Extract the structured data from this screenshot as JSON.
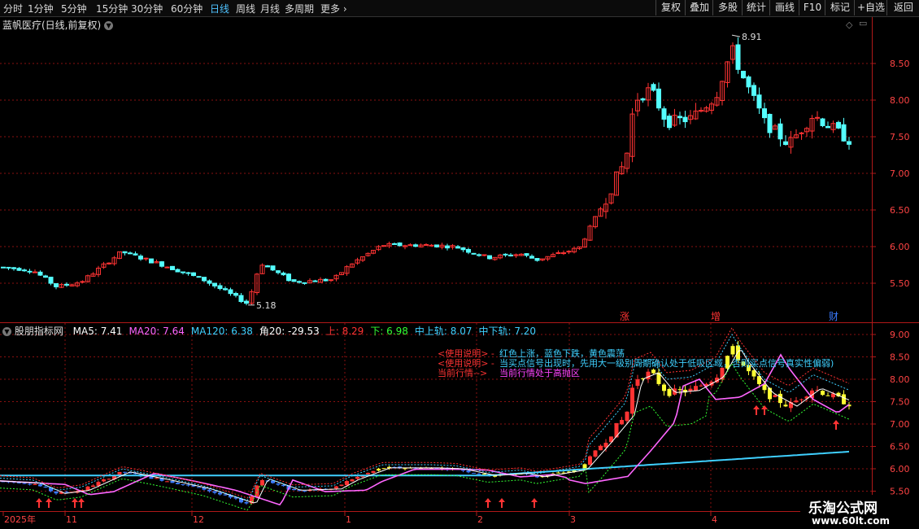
{
  "toolbar": {
    "periods": [
      "分时",
      "1分钟",
      "5分钟",
      "15分钟",
      "30分钟",
      "60分钟",
      "日线",
      "周线",
      "月线",
      "多周期",
      "更多"
    ],
    "active_period": "日线",
    "buttons": [
      "复权",
      "叠加",
      "多股",
      "统计",
      "画线",
      "F10",
      "标记",
      "+自选",
      "返回"
    ]
  },
  "main_chart": {
    "title": "蓝帆医疗(日线,前复权)",
    "y_ticks": [
      "8.50",
      "8.00",
      "7.50",
      "7.00",
      "6.50",
      "6.00",
      "5.50"
    ],
    "high_label": "8.91",
    "low_label": "5.18",
    "event_markers": [
      "涨",
      "增",
      "财"
    ]
  },
  "indicator": {
    "name": "股朋指标网",
    "items": [
      {
        "label": "MA5: 7.41",
        "color": "#ffffff"
      },
      {
        "label": "MA20: 7.64",
        "color": "#ff66ff"
      },
      {
        "label": "MA120: 6.38",
        "color": "#3fd0ff"
      },
      {
        "label": "角20: -29.53",
        "color": "#ffffff"
      },
      {
        "label": "上: 8.29",
        "color": "#ff3333"
      },
      {
        "label": "下: 6.98",
        "color": "#33ff33"
      },
      {
        "label": "中上轨: 8.07",
        "color": "#3fd0ff"
      },
      {
        "label": "中下轨: 7.20",
        "color": "#3fd0ff"
      }
    ],
    "y_ticks": [
      "9.00",
      "8.50",
      "8.00",
      "7.50",
      "7.00",
      "6.50",
      "6.00",
      "5.50"
    ],
    "notes": [
      {
        "prefix": "<使用说明> -",
        "text": "红色上涨，蓝色下跌，黄色震荡",
        "prefix_color": "#ff3333",
        "text_color": "#3fd0ff"
      },
      {
        "prefix": "<使用说明> -",
        "text": "当买点信号出现时，先用大一级别周期确认处于低吸区域，否则买点信号真实性偏弱)",
        "prefix_color": "#ff3333",
        "text_color": "#3fd0ff"
      },
      {
        "prefix": "当前行情-->",
        "text": "当前行情处于高抛区",
        "prefix_color": "#ff3333",
        "text_color": "#ff44ff"
      }
    ]
  },
  "x_axis": {
    "labels": [
      "2025年",
      "11",
      "12",
      "1",
      "2",
      "3",
      "4"
    ]
  },
  "watermark": {
    "line1": "乐淘公式网",
    "line2": "www.60lt.com"
  },
  "colors": {
    "up": "#ff3333",
    "down": "#54ffff",
    "grid": "#8a1010",
    "axis": "#b01818",
    "ma20": "#ff66ff",
    "ma120": "#3fd0ff"
  }
}
